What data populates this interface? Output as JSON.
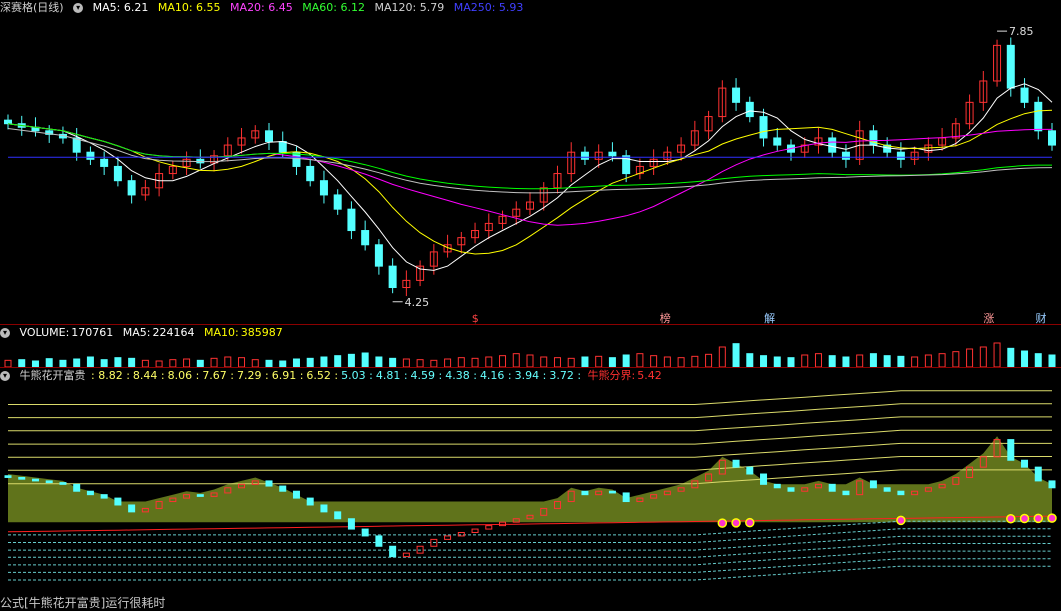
{
  "main_header": {
    "stock_name": "深赛格(日线)",
    "ma5_label": "MA5:",
    "ma5_value": "6.21",
    "ma10_label": "MA10:",
    "ma10_value": "6.55",
    "ma20_label": "MA20:",
    "ma20_value": "6.45",
    "ma60_label": "MA60:",
    "ma60_value": "6.12",
    "ma120_label": "MA120:",
    "ma120_value": "5.79",
    "ma250_label": "MA250:",
    "ma250_value": "5.93"
  },
  "volume_header": {
    "label": "VOLUME:",
    "value": "170761",
    "ma5_label": "MA5:",
    "ma5_value": "224164",
    "ma10_label": "MA10:",
    "ma10_value": "385987"
  },
  "indicator_header": {
    "name": "牛熊花开富贵",
    "values": [
      "8.82",
      "8.44",
      "8.06",
      "7.67",
      "7.29",
      "6.91",
      "6.52",
      "5.03",
      "4.81",
      "4.59",
      "4.38",
      "4.16",
      "3.94",
      "3.72"
    ],
    "boundary_label": "牛熊分界:",
    "boundary_value": "5.42"
  },
  "annotations": {
    "high_label": "7.85",
    "low_label": "4.25",
    "markers": [
      "$",
      "榜",
      "解",
      "涨",
      "财"
    ]
  },
  "footer": {
    "status": "公式[牛熊花开富贵]运行很耗时"
  },
  "colors": {
    "up": "#ff3232",
    "down": "#54ffff",
    "ma5": "#ffffff",
    "ma10": "#ffff00",
    "ma20": "#ff00ff",
    "ma60": "#00ff00",
    "ma120": "#c0c0c0",
    "ma250": "#3030ff",
    "band_upper": "#dada6a",
    "band_lower": "#66cccc",
    "boundary": "#ff2020",
    "fill": "#6a7f1e"
  },
  "chart_data": {
    "type": "candlestick",
    "price_axis_visible_range": [
      4.25,
      7.85
    ],
    "close_series_approx": [
      6.7,
      6.65,
      6.6,
      6.55,
      6.5,
      6.3,
      6.2,
      6.1,
      5.9,
      5.7,
      5.8,
      6.0,
      6.1,
      6.2,
      6.15,
      6.25,
      6.4,
      6.5,
      6.6,
      6.45,
      6.3,
      6.1,
      5.9,
      5.7,
      5.5,
      5.2,
      5.0,
      4.7,
      4.4,
      4.5,
      4.7,
      4.9,
      5.0,
      5.1,
      5.2,
      5.3,
      5.4,
      5.5,
      5.6,
      5.8,
      6.0,
      6.3,
      6.2,
      6.3,
      6.25,
      6.0,
      6.1,
      6.2,
      6.3,
      6.4,
      6.6,
      6.8,
      7.2,
      7.0,
      6.8,
      6.5,
      6.4,
      6.3,
      6.4,
      6.5,
      6.3,
      6.2,
      6.6,
      6.4,
      6.3,
      6.2,
      6.3,
      6.4,
      6.5,
      6.7,
      7.0,
      7.3,
      7.8,
      7.2,
      7.0,
      6.6,
      6.4
    ],
    "volume_series_approx": [
      20,
      22,
      18,
      25,
      20,
      24,
      30,
      22,
      28,
      26,
      20,
      18,
      22,
      24,
      20,
      26,
      30,
      28,
      22,
      20,
      18,
      24,
      26,
      30,
      34,
      38,
      42,
      30,
      26,
      24,
      22,
      20,
      24,
      28,
      26,
      30,
      34,
      40,
      36,
      30,
      28,
      26,
      30,
      32,
      28,
      36,
      40,
      34,
      30,
      28,
      32,
      38,
      60,
      70,
      40,
      34,
      30,
      28,
      36,
      40,
      34,
      30,
      36,
      40,
      34,
      32,
      30,
      36,
      40,
      46,
      54,
      60,
      72,
      56,
      48,
      40,
      36
    ],
    "indicator_levels": [
      8.82,
      8.44,
      8.06,
      7.67,
      7.29,
      6.91,
      6.52,
      5.03,
      4.81,
      4.59,
      4.38,
      4.16,
      3.94,
      3.72
    ],
    "bull_bear_boundary": 5.42
  }
}
